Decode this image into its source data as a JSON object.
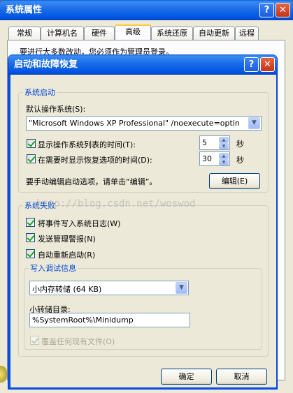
{
  "back_window": {
    "title": "系统属性",
    "tabs": [
      "常规",
      "计算机名",
      "硬件",
      "高级",
      "系统还原",
      "自动更新",
      "远程"
    ],
    "active_tab": "高级",
    "notice": "要进行大多数改动，您必须作为管理员登录。"
  },
  "dialog": {
    "title": "启动和故障恢复",
    "help_glyph": "?",
    "close_glyph": "✕",
    "startup": {
      "legend": "系统启动",
      "default_os_label": "默认操作系统(S):",
      "default_os_value": "\"Microsoft Windows XP Professional\" /noexecute=optin",
      "show_list_label": "显示操作系统列表的时间(T):",
      "show_list_value": "5",
      "show_recovery_label": "在需要时显示恢复选项的时间(D):",
      "show_recovery_value": "30",
      "seconds_unit": "秒",
      "edit_hint": "要手动编辑启动选项，请单击“编辑”。",
      "edit_button": "编辑(E)"
    },
    "failure": {
      "legend": "系统失败",
      "write_event_label": "将事件写入系统日志(W)",
      "send_alert_label": "发送管理警报(N)",
      "auto_restart_label": "自动重新启动(R)",
      "debug_legend": "写入调试信息",
      "debug_type": "小内存转储 (64 KB)",
      "dump_dir_label": "小转储目录:",
      "dump_dir_value": "%SystemRoot%\\Minidump",
      "overwrite_label": "覆盖任何现有文件(O)"
    },
    "ok_button": "确定",
    "cancel_button": "取消"
  },
  "watermark": "http://blog.csdn.net/woswod",
  "colors": {
    "titlebar": "#0054e3",
    "legend": "#0046d5",
    "face": "#ece9d8"
  }
}
